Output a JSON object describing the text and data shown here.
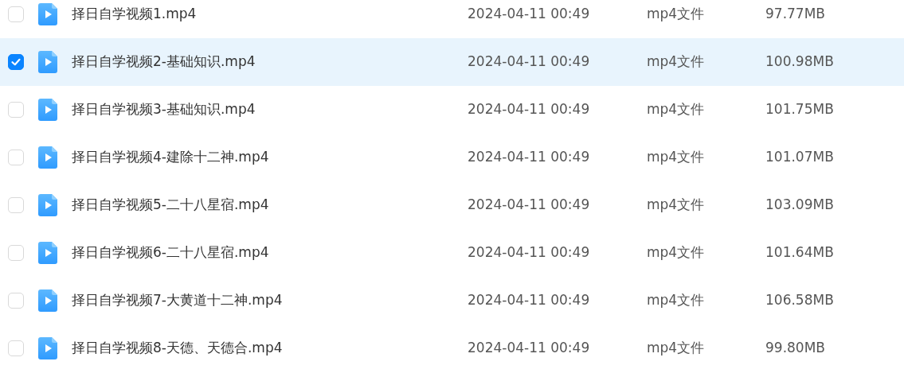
{
  "files": [
    {
      "name": "择日自学视频1.mp4",
      "date": "2024-04-11 00:49",
      "type": "mp4文件",
      "size": "97.77MB",
      "selected": false
    },
    {
      "name": "择日自学视频2-基础知识.mp4",
      "date": "2024-04-11 00:49",
      "type": "mp4文件",
      "size": "100.98MB",
      "selected": true
    },
    {
      "name": "择日自学视频3-基础知识.mp4",
      "date": "2024-04-11 00:49",
      "type": "mp4文件",
      "size": "101.75MB",
      "selected": false
    },
    {
      "name": "择日自学视频4-建除十二神.mp4",
      "date": "2024-04-11 00:49",
      "type": "mp4文件",
      "size": "101.07MB",
      "selected": false
    },
    {
      "name": "择日自学视频5-二十八星宿.mp4",
      "date": "2024-04-11 00:49",
      "type": "mp4文件",
      "size": "103.09MB",
      "selected": false
    },
    {
      "name": "择日自学视频6-二十八星宿.mp4",
      "date": "2024-04-11 00:49",
      "type": "mp4文件",
      "size": "101.64MB",
      "selected": false
    },
    {
      "name": "择日自学视频7-大黄道十二神.mp4",
      "date": "2024-04-11 00:49",
      "type": "mp4文件",
      "size": "106.58MB",
      "selected": false
    },
    {
      "name": "择日自学视频8-天德、天德合.mp4",
      "date": "2024-04-11 00:49",
      "type": "mp4文件",
      "size": "99.80MB",
      "selected": false
    }
  ]
}
